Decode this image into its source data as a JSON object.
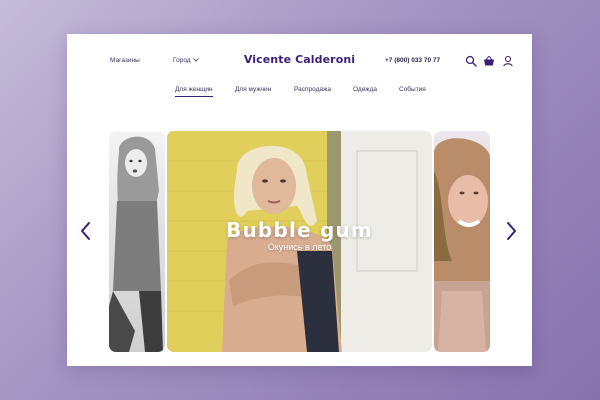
{
  "header": {
    "stores_label": "Магазины",
    "city_label": "Город",
    "brand": "Vicente Calderoni",
    "phone": "+7 (800) 033 70 77"
  },
  "icons": {
    "search": "search-icon",
    "cart": "basket-icon",
    "account": "user-icon",
    "city_dropdown": "chevron-down-icon",
    "prev": "chevron-left-icon",
    "next": "chevron-right-icon"
  },
  "tabs": [
    {
      "label": "Для женщин",
      "active": true
    },
    {
      "label": "Для мужчин",
      "active": false
    },
    {
      "label": "Распродажа",
      "active": false
    },
    {
      "label": "Одежда",
      "active": false
    },
    {
      "label": "События",
      "active": false
    }
  ],
  "hero": {
    "title": "Bubble gum",
    "subtitle": "Окунись в лето"
  },
  "colors": {
    "brand": "#3a1f7a",
    "text": "#3b3357",
    "hero_yellow": "#e3d35e"
  }
}
